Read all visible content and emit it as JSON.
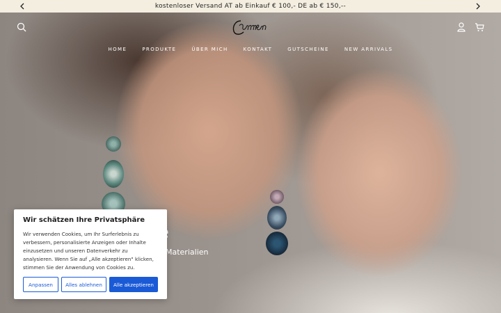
{
  "announcement": {
    "text": "kostenloser Versand AT ab Einkauf € 100,- DE ab € 150,--",
    "prev_icon": "chevron-left-icon",
    "next_icon": "chevron-right-icon"
  },
  "header": {
    "logo_text": "Carmen",
    "icons": [
      "search-icon",
      "account-icon",
      "cart-icon"
    ]
  },
  "nav": {
    "items": [
      "HOME",
      "PRODUKTE",
      "ÜBER MICH",
      "KONTAKT",
      "GUTSCHEINE",
      "NEW ARRIVALS"
    ]
  },
  "hero": {
    "heading_fragment": "e",
    "subheading_fragment": "Materialien"
  },
  "cookie": {
    "title": "Wir schätzen Ihre Privatsphäre",
    "text": "Wir verwenden Cookies, um Ihr Surferlebnis zu verbessern, personalisierte Anzeigen oder Inhalte einzusetzen und unseren Datenverkehr zu analysieren. Wenn Sie auf „Alle akzeptieren\" klicken, stimmen Sie der Anwendung von Cookies zu.",
    "customize_label": "Anpassen",
    "reject_label": "Alles ablehnen",
    "accept_label": "Alle akzeptieren",
    "accent_color": "#1a5ad6"
  }
}
